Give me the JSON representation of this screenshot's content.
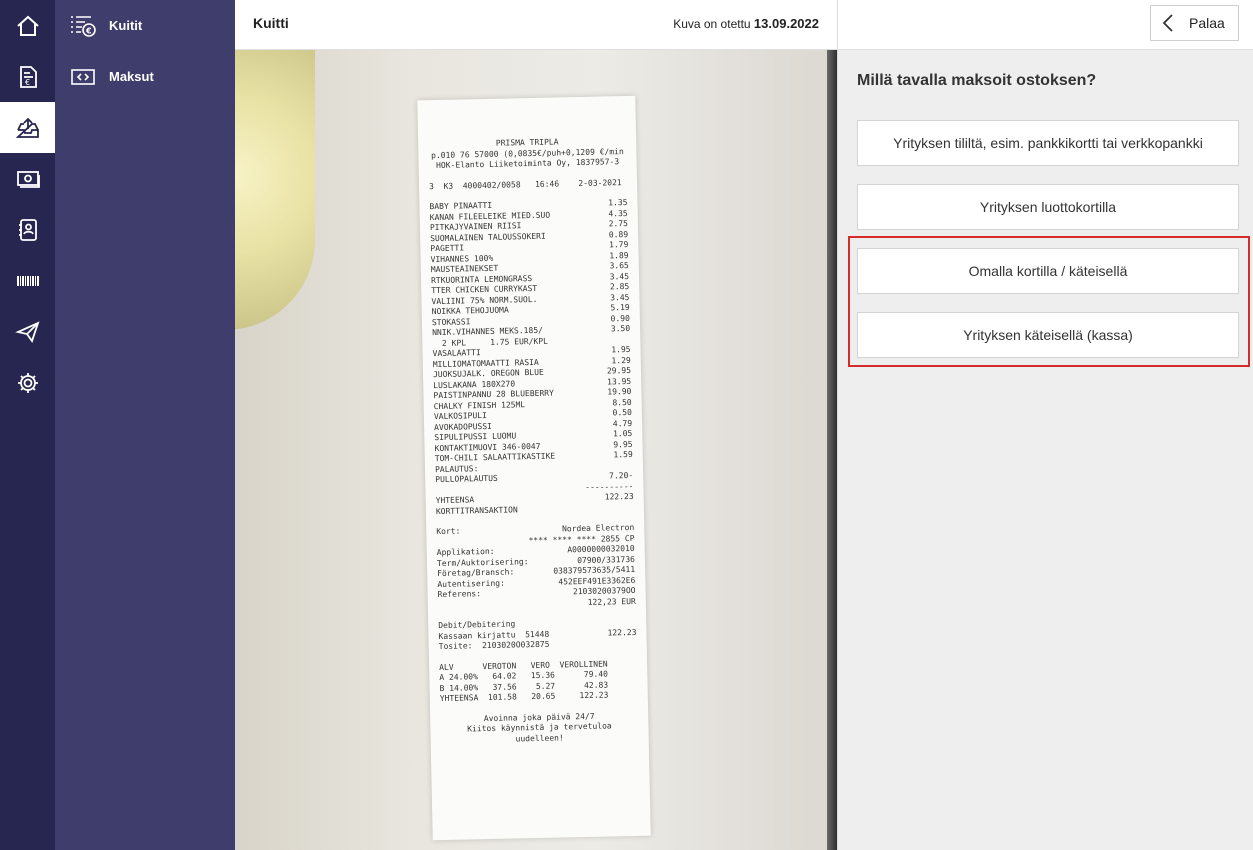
{
  "rail": {
    "items": [
      {
        "icon": "home-icon",
        "active": false
      },
      {
        "icon": "invoice-icon",
        "active": false
      },
      {
        "icon": "inbox-upload-icon",
        "active": true
      },
      {
        "icon": "money-icon",
        "active": false
      },
      {
        "icon": "contacts-icon",
        "active": false
      },
      {
        "icon": "barcode-icon",
        "active": false
      },
      {
        "icon": "send-icon",
        "active": false
      },
      {
        "icon": "gear-icon",
        "active": false
      }
    ]
  },
  "subnav": {
    "items": [
      {
        "label": "Kuitit",
        "icon": "receipt-list-icon"
      },
      {
        "label": "Maksut",
        "icon": "banknote-icon"
      }
    ]
  },
  "header": {
    "title": "Kuitti",
    "date_prefix": "Kuva on otettu",
    "date": "13.09.2022"
  },
  "receipt": {
    "lines": [
      "PRISMA TRIPLA",
      "p.010 76 57000 (0,0835€/puh+0,1209 €/min",
      "HOK-Elanto Liiketoiminta Oy, 1837957-3",
      "3  K3  4000402/0058   16:46    2-03-2021",
      "BABY PINAATTI|1.35",
      "KANAN FILEELEIKE MIED.SUO|4.35",
      "PITKAJYVAINEN RIISI|2.75",
      "SUOMALAINEN TALOUSSOKERI|0.89",
      "PAGETTI|1.79",
      "VIHANNES 100%|1.89",
      "MAUSTEAINEKSET|3.65",
      "RTKUORINTA LEMONGRASS|3.45",
      "TTER CHICKEN CURRYKAST|2.85",
      "VALIINI 75% NORM.SUOL.|3.45",
      "NOIKKA TEHOJUOMA|5.19",
      "STOKASSI|0.90",
      "NNIK.VIHANNES MEKS.185/|3.50",
      "  2 KPL     1.75 EUR/KPL|",
      "VASALAATTI|1.95",
      "MILLIOMATOMAATTI RASIA|1.29",
      "JUOKSUJALK. OREGON BLUE|29.95",
      "LUSLAKANA 180X270|13.95",
      "PAISTINPANNU 28 BLUEBERRY|19.90",
      "CHALKY FINISH 125ML|8.50",
      "VALKOSIPULI|0.50",
      "AVOKADOPUSSI|4.79",
      "SIPULIPUSSI LUOMU|1.05",
      "KONTAKTIMUOVI 346-0047|9.95",
      "TOM-CHILI SALAATTIKASTIKE|1.59",
      "PALAUTUS:|",
      "PULLOPALAUTUS|7.20-",
      "|----------",
      "YHTEENSA|122.23",
      "KORTTITRANSAKTION|",
      "Kort:|Nordea Electron",
      "|**** **** **** 2855 CP",
      "Applikation:|A0000000032010",
      "Term/Auktorisering:|07900/331736",
      "Företag/Bransch:|038379573635/5411",
      "Autentisering:|452EEF491E3362E6",
      "Referens:|21030200379OO",
      "|122,23 EUR",
      "Debit/Debitering|",
      "Kassaan kirjattu  51448|122.23",
      "Tosite:  2103020O032875|",
      "ALV      VEROTON   VERO  VEROLLINEN",
      "A 24.00%   64.02   15.36      79.40",
      "B 14.00%   37.56    5.27      42.83",
      "YHTEENSA  101.58   20.65     122.23",
      "Avoinna joka päivä 24/7",
      "Kiitos käynnistä ja tervetuloa",
      "uudelleen!"
    ]
  },
  "panel": {
    "back_label": "Palaa",
    "question": "Millä tavalla maksoit ostoksen?",
    "options": [
      "Yrityksen tililtä, esim. pankkikortti tai verkkopankki",
      "Yrityksen luottokortilla",
      "Omalla kortilla / käteisellä",
      "Yrityksen käteisellä (kassa)"
    ],
    "highlight_color": "#d52b2b"
  },
  "colors": {
    "rail_bg": "#262650",
    "subnav_bg": "#3e3d6b",
    "panel_bg": "#eeeeee"
  }
}
